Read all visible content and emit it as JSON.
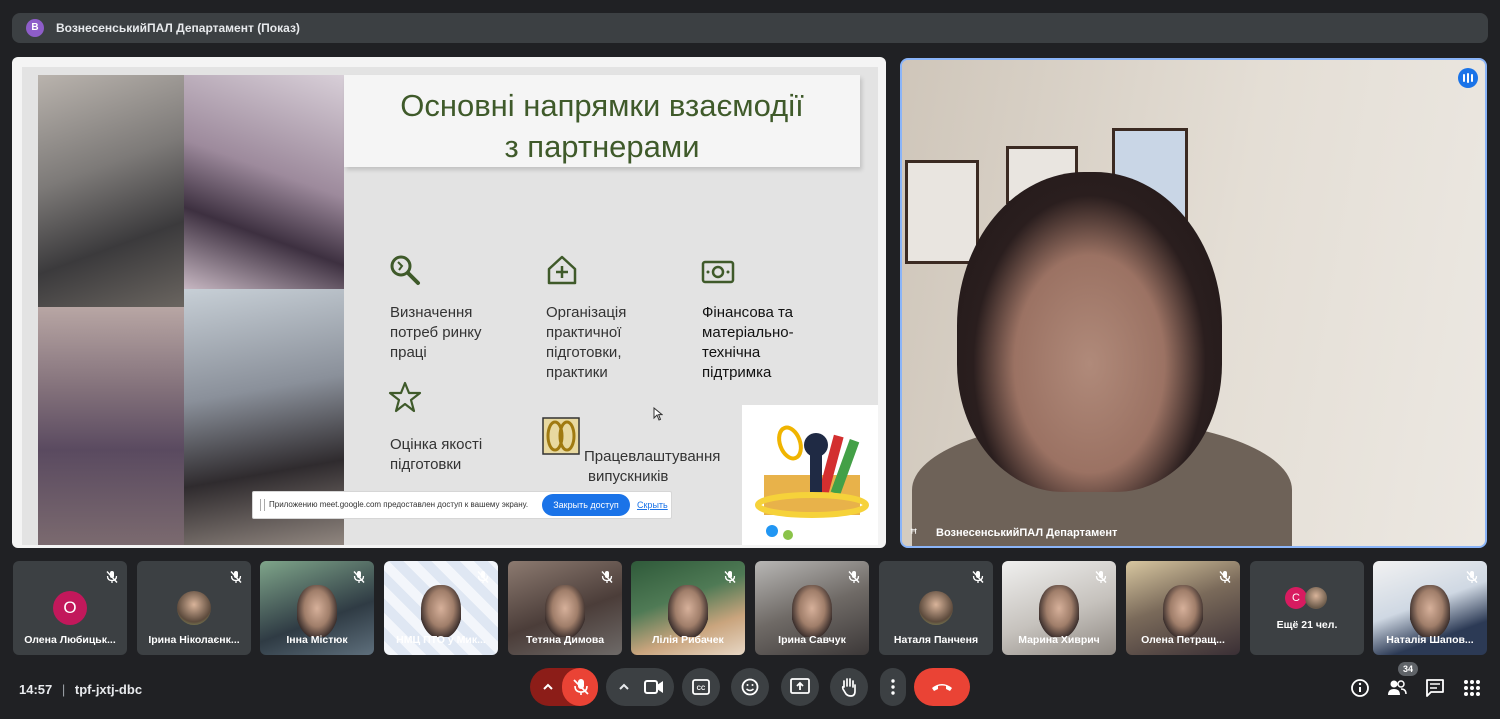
{
  "header": {
    "avatar_letter": "В",
    "title": "ВознесенськийПАЛ Департамент (Показ)"
  },
  "slide": {
    "title_line1": "Основні напрямки взаємодії",
    "title_line2": "з партнерами",
    "items": [
      {
        "icon": "search-icon",
        "lines": [
          "Визначення",
          "потреб ринку",
          "праці"
        ]
      },
      {
        "icon": "house-plus-icon",
        "lines": [
          "Організація",
          "практичної",
          "підготовки,",
          "практики"
        ]
      },
      {
        "icon": "money-icon",
        "lines": [
          "Фінансова та",
          "матеріально-",
          "технічна",
          "підтримка"
        ]
      },
      {
        "icon": "star-icon",
        "lines": [
          "Оцінка якості",
          "підготовки"
        ]
      },
      {
        "icon": "scissors-icon",
        "lines": [
          "Працевлаштування",
          "випускників"
        ]
      }
    ]
  },
  "share_notice": {
    "message": "Приложению meet.google.com предоставлен доступ к вашему экрану.",
    "stop_label": "Закрыть доступ",
    "hide_label": "Скрыть"
  },
  "speaker": {
    "name": "ВознесенськийПАЛ Департамент"
  },
  "participants": [
    {
      "name": "Олена Любицьк...",
      "avatar_letter": "О",
      "avatar_color": "#c2185b",
      "kind": "letter"
    },
    {
      "name": "Ірина Ніколаєнк...",
      "kind": "photo-avatar"
    },
    {
      "name": "Інна Містюк",
      "kind": "video"
    },
    {
      "name": "НМЦ ПТО у Мик...",
      "kind": "video"
    },
    {
      "name": "Тетяна Димова",
      "kind": "video"
    },
    {
      "name": "Лілія Рибачек",
      "kind": "video"
    },
    {
      "name": "Ірина Савчук",
      "kind": "video"
    },
    {
      "name": "Наталя Панченя",
      "kind": "photo-avatar"
    },
    {
      "name": "Марина Хиврич",
      "kind": "video"
    },
    {
      "name": "Олена Петращ...",
      "kind": "video"
    },
    {
      "name": "Ещё 21 чел.",
      "avatar_letter": "С",
      "avatar_color": "#d81b60",
      "kind": "more"
    },
    {
      "name": "Наталія Шапов...",
      "kind": "video"
    }
  ],
  "bottom": {
    "time": "14:57",
    "meeting_code": "tpf-jxtj-dbc",
    "people_count": "34"
  },
  "colors": {
    "accent": "#1a73e8",
    "danger": "#ea4335",
    "bar": "#3c4043",
    "bg": "#202124"
  }
}
